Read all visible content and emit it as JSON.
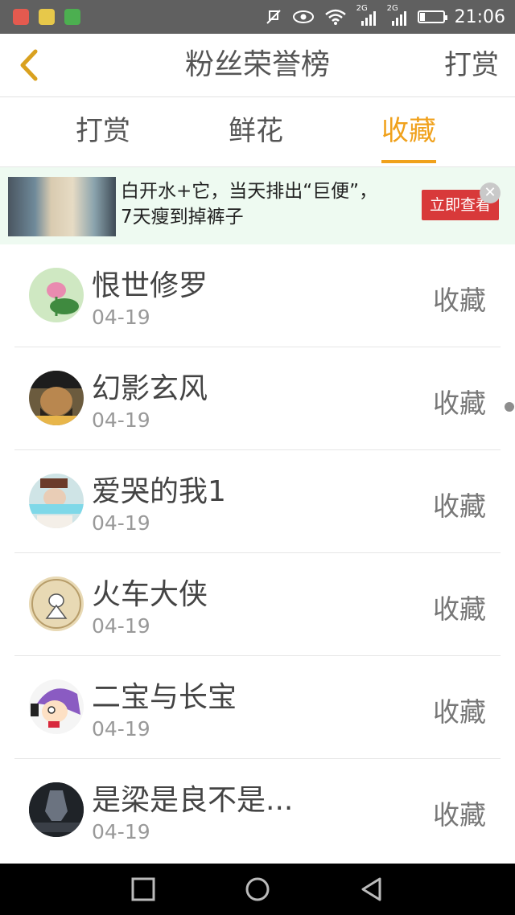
{
  "status_bar": {
    "time": "21:06",
    "network_labels": [
      "2G",
      "2G"
    ],
    "apps": [
      {
        "icon": "app-icon-colorful",
        "color": "#d9534f"
      },
      {
        "icon": "app-icon-chat",
        "color": "#e7c84a"
      },
      {
        "icon": "app-icon-green",
        "color": "#4caf50"
      }
    ]
  },
  "header": {
    "title": "粉丝荣誉榜",
    "right_action": "打赏",
    "back_icon": "chevron-left-icon"
  },
  "tabs": [
    {
      "label": "打赏",
      "active": false
    },
    {
      "label": "鲜花",
      "active": false
    },
    {
      "label": "收藏",
      "active": true
    }
  ],
  "ad": {
    "line1": "白开水+它，当天排出“巨便”，",
    "line2": "7天瘦到掉裤子",
    "cta": "立即查看",
    "close_icon": "close-icon"
  },
  "fans": [
    {
      "name": "恨世修罗",
      "date": "04-19",
      "action": "收藏",
      "avatar_color": "#cfe8c2",
      "avatar_icon": "lotus-icon"
    },
    {
      "name": "幻影玄风",
      "date": "04-19",
      "action": "收藏",
      "avatar_color": "#6b5b3e",
      "avatar_icon": "cartoon-face-icon"
    },
    {
      "name": "爱哭的我1",
      "date": "04-19",
      "action": "收藏",
      "avatar_color": "#cfe4e6",
      "avatar_icon": "person-hat-icon"
    },
    {
      "name": "火车大侠",
      "date": "04-19",
      "action": "收藏",
      "avatar_color": "#e8d9b4",
      "avatar_icon": "cat-sketch-icon"
    },
    {
      "name": "二宝与长宝",
      "date": "04-19",
      "action": "收藏",
      "avatar_color": "#d9c6ef",
      "avatar_icon": "anime-character-icon"
    },
    {
      "name": "是梁是良不是...",
      "date": "04-19",
      "action": "收藏",
      "avatar_color": "#2b2f36",
      "avatar_icon": "dark-knight-icon"
    }
  ],
  "nav": [
    "square-icon",
    "circle-icon",
    "triangle-back-icon"
  ]
}
